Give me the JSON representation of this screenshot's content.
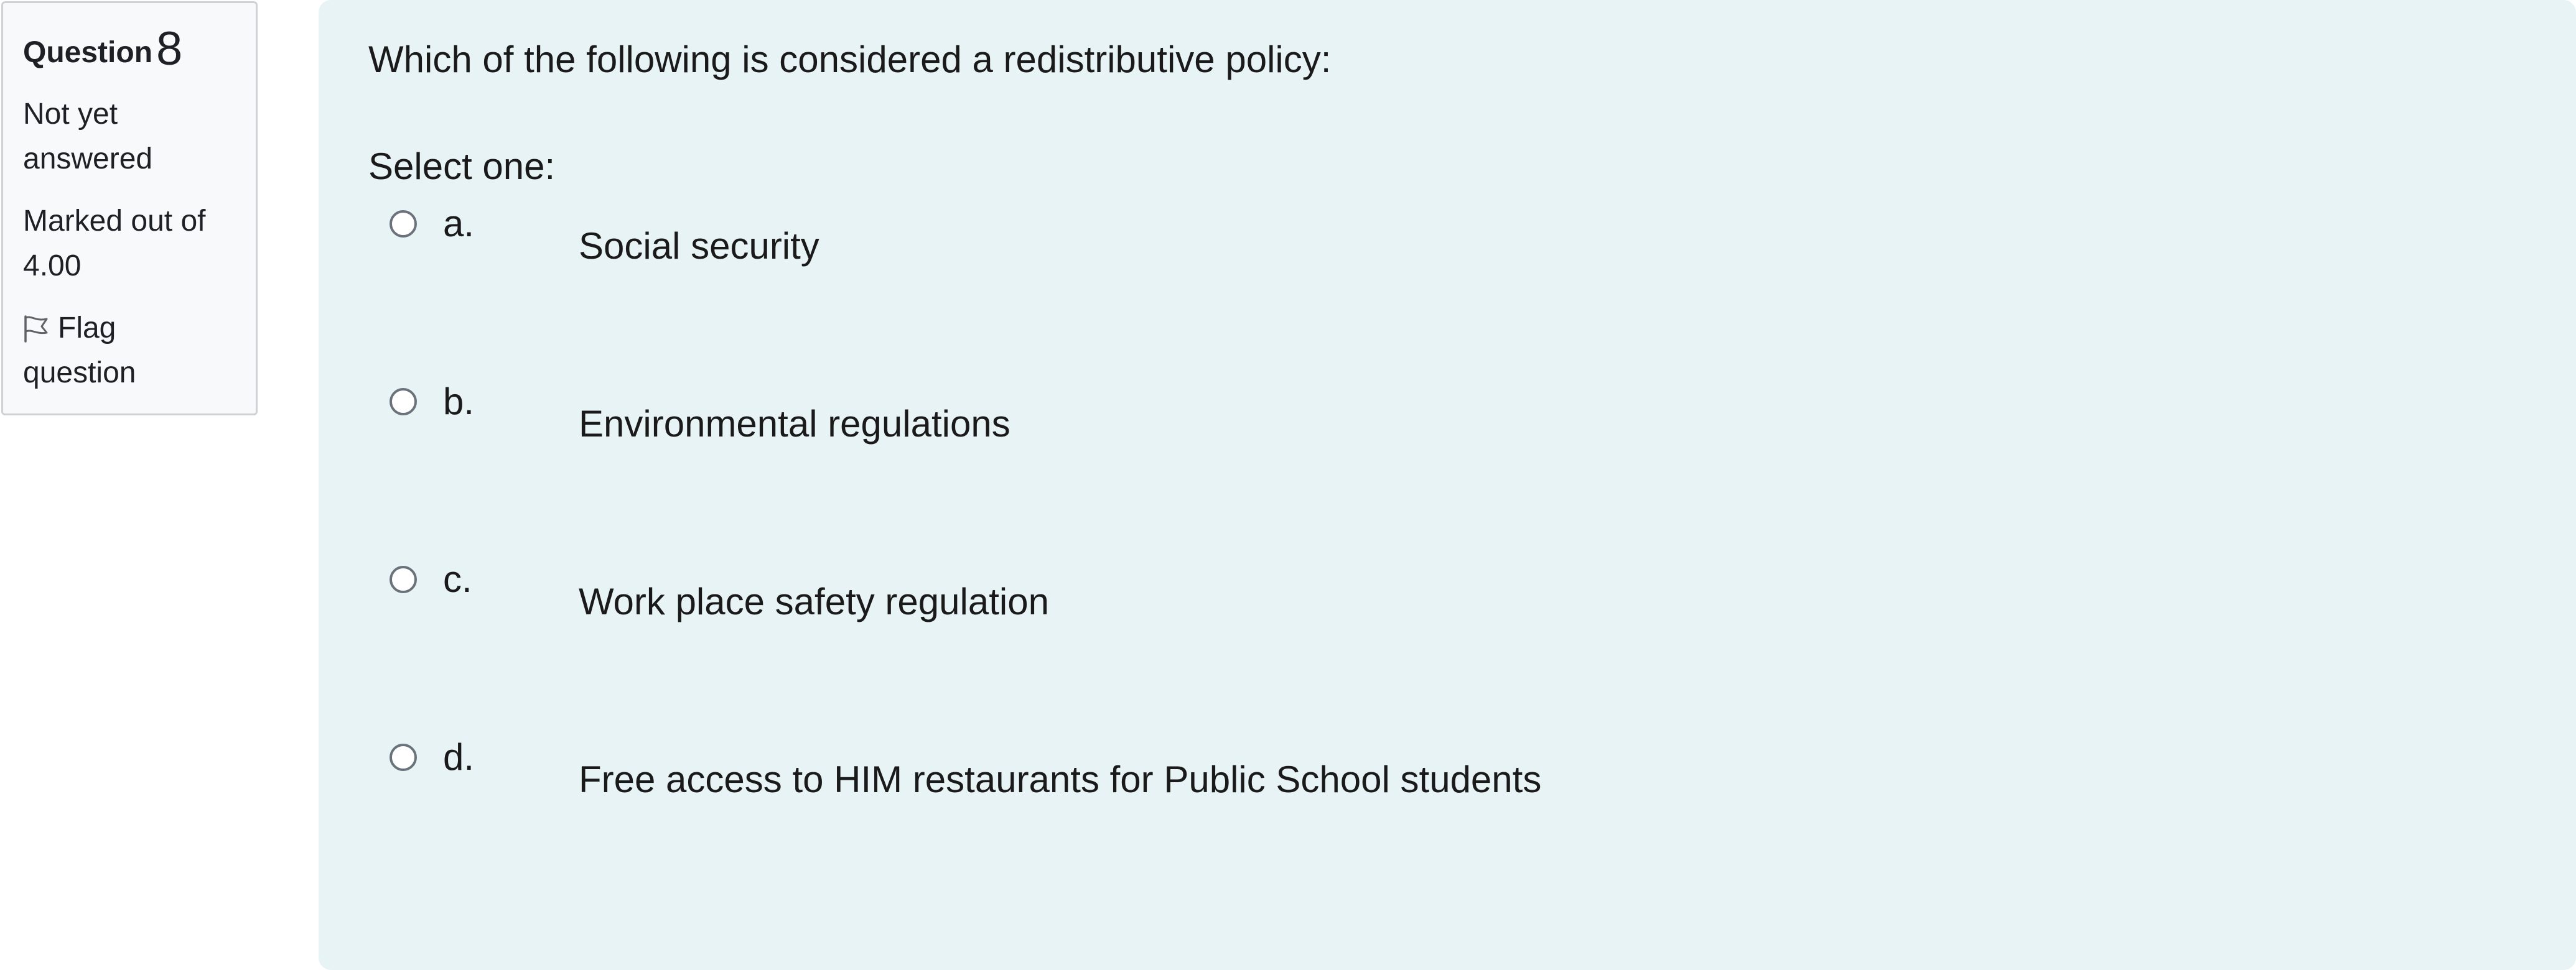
{
  "info": {
    "question_label": "Question",
    "question_number": "8",
    "state_line1": "Not yet",
    "state_line2": "answered",
    "marked_line1": "Marked out of",
    "marked_line2": "4.00",
    "flag_line1": "Flag",
    "flag_line2": "question",
    "flag_icon": "flag-icon"
  },
  "question": {
    "text": "Which of the following is considered a redistributive policy:",
    "prompt": "Select one:",
    "answers": [
      {
        "letter": "a.",
        "label": "Social security",
        "selected": false
      },
      {
        "letter": "b.",
        "label": "Environmental regulations",
        "selected": false
      },
      {
        "letter": "c.",
        "label": "Work place safety regulation",
        "selected": false
      },
      {
        "letter": "d.",
        "label": "Free access to HIM restaurants for Public School students",
        "selected": false
      }
    ]
  },
  "colors": {
    "content_background": "#e7f3f5",
    "info_background": "#f8f9fa",
    "text": "#1d2125"
  }
}
